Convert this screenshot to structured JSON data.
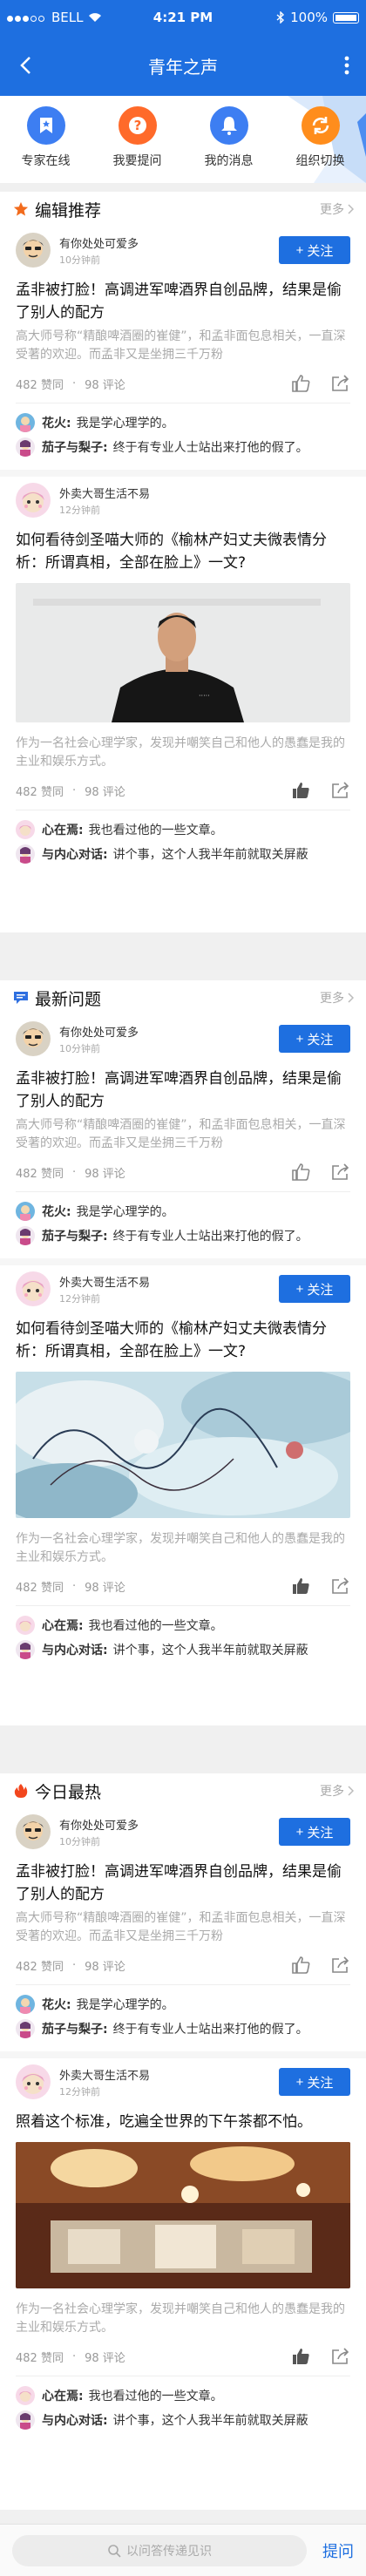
{
  "status": {
    "carrier": "BELL",
    "time": "4:21 PM",
    "battery": "100%"
  },
  "nav": {
    "title": "青年之声"
  },
  "menu": [
    {
      "label": "专家在线",
      "icon": "bookmark-icon",
      "color": "#3d7ef2"
    },
    {
      "label": "我要提问",
      "icon": "question-icon",
      "color": "#ff6a2a"
    },
    {
      "label": "我的消息",
      "icon": "bell-icon",
      "color": "#3d7ef2"
    },
    {
      "label": "组织切换",
      "icon": "switch-icon",
      "color": "#ff8d1c"
    }
  ],
  "common": {
    "more": "更多",
    "follow": "关注"
  },
  "search": {
    "placeholder": "以问答传递见识",
    "ask": "提问"
  },
  "sections": [
    {
      "title": "编辑推荐",
      "posts": [
        {
          "author": "有你处处可爱多",
          "time": "10分钟前",
          "title": "孟非被打脸！高调进军啤酒界自创品牌，结果是偷了别人的配方",
          "excerpt": "高大师号称“精酿啤酒圈的崔健”，和孟非面包息相关，一直深受著的欢迎。而孟非又是坐拥三千万粉",
          "likes": "482 赞同",
          "comments": "98 评论",
          "comment_list": [
            {
              "name": "花火:",
              "text": "我是学心理学的。"
            },
            {
              "name": "茄子与梨子:",
              "text": "终于有专业人士站出来打他的假了。"
            }
          ]
        },
        {
          "author": "外卖大哥生活不易",
          "time": "12分钟前",
          "title": "如何看待剑圣喵大师的《榆林产妇丈夫微表情分析：所谓真相，全部在脸上》一文?",
          "excerpt": "作为一名社会心理学家，发现并嘲笑自己和他人的愚蠢是我的主业和娱乐方式。",
          "likes": "482 赞同",
          "comments": "98 评论",
          "comment_list": [
            {
              "name": "心在焉:",
              "text": "我也看过他的一些文章。"
            },
            {
              "name": "与内心对话:",
              "text": "讲个事，这个人我半年前就取关屏蔽"
            }
          ]
        }
      ]
    },
    {
      "title": "最新问题",
      "posts": [
        {
          "author": "有你处处可爱多",
          "time": "10分钟前",
          "title": "孟非被打脸！高调进军啤酒界自创品牌，结果是偷了别人的配方",
          "excerpt": "高大师号称“精酿啤酒圈的崔健”，和孟非面包息相关，一直深受著的欢迎。而孟非又是坐拥三千万粉",
          "likes": "482 赞同",
          "comments": "98 评论",
          "comment_list": [
            {
              "name": "花火:",
              "text": "我是学心理学的。"
            },
            {
              "name": "茄子与梨子:",
              "text": "终于有专业人士站出来打他的假了。"
            }
          ]
        },
        {
          "author": "外卖大哥生活不易",
          "time": "12分钟前",
          "title": "如何看待剑圣喵大师的《榆林产妇丈夫微表情分析：所谓真相，全部在脸上》一文?",
          "excerpt": "作为一名社会心理学家，发现并嘲笑自己和他人的愚蠢是我的主业和娱乐方式。",
          "likes": "482 赞同",
          "comments": "98 评论",
          "comment_list": [
            {
              "name": "心在焉:",
              "text": "我也看过他的一些文章。"
            },
            {
              "name": "与内心对话:",
              "text": "讲个事，这个人我半年前就取关屏蔽"
            }
          ]
        }
      ]
    },
    {
      "title": "今日最热",
      "posts": [
        {
          "author": "有你处处可爱多",
          "time": "10分钟前",
          "title": "孟非被打脸！高调进军啤酒界自创品牌，结果是偷了别人的配方",
          "excerpt": "高大师号称“精酿啤酒圈的崔健”，和孟非面包息相关，一直深受著的欢迎。而孟非又是坐拥三千万粉",
          "likes": "482 赞同",
          "comments": "98 评论",
          "comment_list": [
            {
              "name": "花火:",
              "text": "我是学心理学的。"
            },
            {
              "name": "茄子与梨子:",
              "text": "终于有专业人士站出来打他的假了。"
            }
          ]
        },
        {
          "author": "外卖大哥生活不易",
          "time": "12分钟前",
          "title": "照着这个标准，吃遍全世界的下午茶都不怕。",
          "excerpt": "作为一名社会心理学家，发现并嘲笑自己和他人的愚蠢是我的主业和娱乐方式。",
          "likes": "482 赞同",
          "comments": "98 评论",
          "comment_list": [
            {
              "name": "心在焉:",
              "text": "我也看过他的一些文章。"
            },
            {
              "name": "与内心对话:",
              "text": "讲个事，这个人我半年前就取关屏蔽"
            }
          ]
        }
      ]
    }
  ]
}
